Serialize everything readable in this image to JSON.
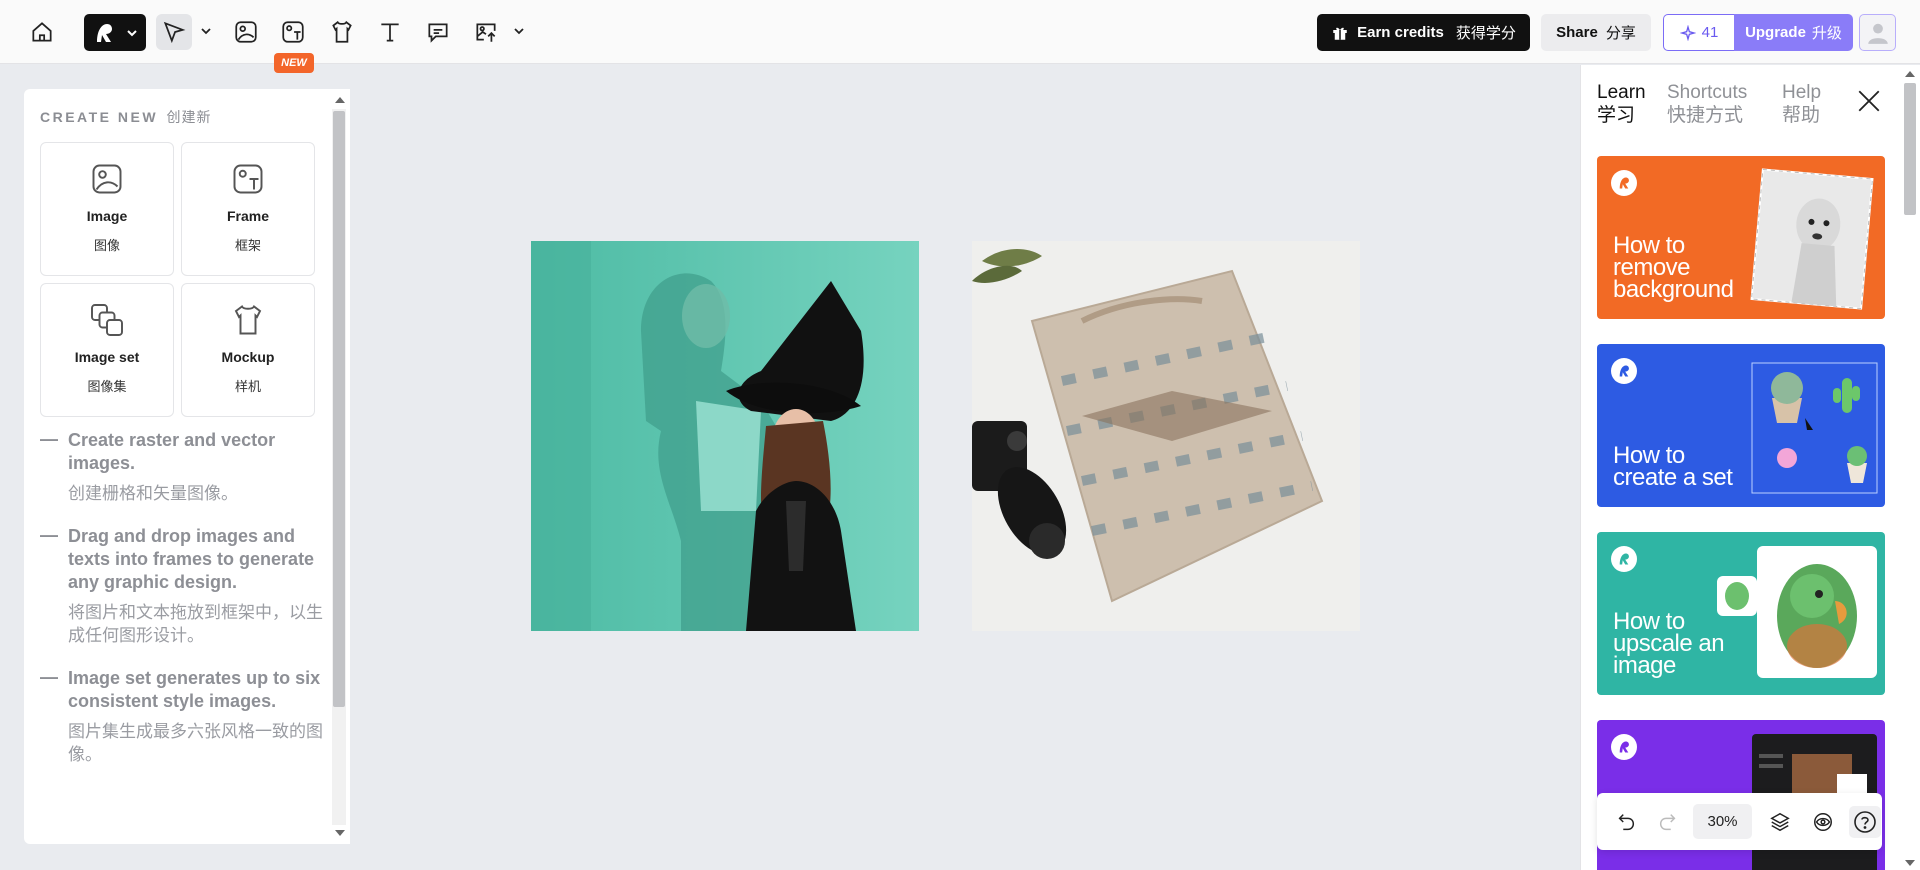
{
  "topbar": {
    "earn_credits": "Earn credits",
    "earn_credits_cn": "获得学分",
    "share": "Share",
    "share_cn": "分享",
    "credits": "41",
    "upgrade": "Upgrade",
    "upgrade_cn": "升级",
    "new_badge": "NEW"
  },
  "left_panel": {
    "title": "CREATE NEW",
    "title_cn": "创建新",
    "cards": [
      {
        "label": "Image",
        "label_cn": "图像"
      },
      {
        "label": "Frame",
        "label_cn": "框架"
      },
      {
        "label": "Image set",
        "label_cn": "图像集"
      },
      {
        "label": "Mockup",
        "label_cn": "样机"
      }
    ],
    "tips": [
      {
        "en": "Create raster and vector images.",
        "zh": "创建栅格和矢量图像。"
      },
      {
        "en": "Drag and drop images and texts into frames to generate any graphic design.",
        "zh": "将图片和文本拖放到框架中，以生成任何图形设计。"
      },
      {
        "en": "Image set generates up to six consistent style images.",
        "zh": "图片集生成最多六张风格一致的图像。"
      }
    ]
  },
  "right_panel": {
    "tabs": [
      {
        "label": "Learn",
        "label_cn": "学习"
      },
      {
        "label": "Shortcuts",
        "label_cn": "快捷方式"
      },
      {
        "label": "Help",
        "label_cn": "帮助"
      }
    ],
    "cards": [
      {
        "title": "How to remove background",
        "color": "#f26a25"
      },
      {
        "title": "How to create a set",
        "color": "#2d5be3"
      },
      {
        "title": "How to upscale an image",
        "color": "#2fb5a4"
      },
      {
        "title": "",
        "color": "#7a2ee8"
      }
    ]
  },
  "bottom_bar": {
    "zoom": "30%"
  },
  "colors": {
    "accent": "#8a7cf8",
    "badge": "#f3652a",
    "canvas_bg": "#e9ebef"
  }
}
